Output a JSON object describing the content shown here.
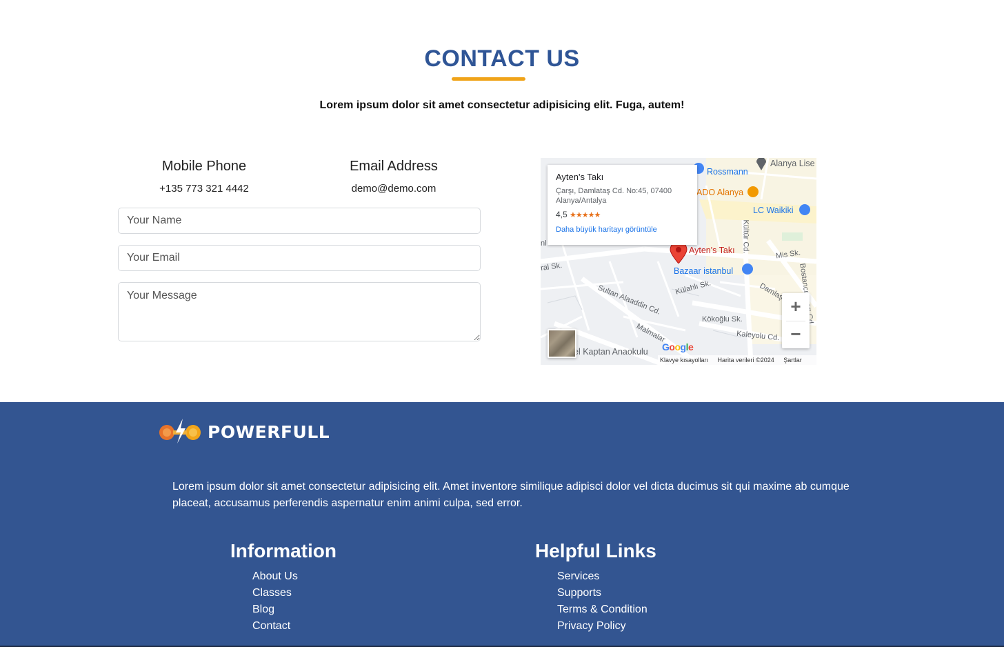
{
  "contact": {
    "title": "CONTACT US",
    "lead": "Lorem ipsum dolor sit amet consectetur adipisicing elit. Fuga, autem!",
    "accent_color": "#f0a318",
    "title_color": "#2f5596",
    "phone": {
      "label": "Mobile Phone",
      "value": "+135 773 321 4442"
    },
    "email": {
      "label": "Email Address",
      "value": "demo@demo.com"
    },
    "form": {
      "name_placeholder": "Your Name",
      "email_placeholder": "Your Email",
      "message_placeholder": "Your Message"
    }
  },
  "map": {
    "card": {
      "title": "Ayten's Takı",
      "address": "Çarşı, Damlataş Cd. No:45, 07400 Alanya/Antalya",
      "rating": "4,5",
      "stars": "★★★★★",
      "link": "Daha büyük haritayı görüntüle"
    },
    "places": {
      "alanya_lise": "Alanya Lise",
      "rossmann": "Rossmann",
      "ado_alanya": "ADO Alanya",
      "lc_waikiki": "LC Waikiki",
      "aytens_taki": "Ayten's Takı",
      "bazaar_istanbul": "Bazaar istanbul",
      "mis_sk": "Mis Sk.",
      "kulahli_sk": "Külahlı Sk.",
      "kokoglu_sk": "Kökoğlu Sk.",
      "kaleyolu_cd": "Kaleyolu Cd.",
      "sultan_alaaddin_cd": "Sultan Alaaddin Cd.",
      "malmalar": "Malmalar",
      "kaptan_anaokulu": "el Kaptan Anaokulu",
      "kultur_cd": "Kültür Cd.",
      "bostancipinari_cd": "Bostancıpınarı Cd.",
      "damlatas": "Damlaş",
      "ral_sk": "ral Sk.",
      "nl": "nl"
    },
    "google": "Google",
    "footer": {
      "shortcuts": "Klavye kısayolları",
      "data": "Harita verileri ©2024",
      "terms": "Şartlar"
    },
    "zoom_in": "+",
    "zoom_out": "−"
  },
  "footer": {
    "background": "#335591",
    "brand": "POWERFULL",
    "about": "Lorem ipsum dolor sit amet consectetur adipisicing elit. Amet inventore similique adipisci dolor vel dicta ducimus sit qui maxime ab cumque placeat, accusamus perferendis aspernatur enim animi culpa, sed error.",
    "information": {
      "heading": "Information",
      "links": [
        "About Us",
        "Classes",
        "Blog",
        "Contact"
      ]
    },
    "helpful": {
      "heading": "Helpful Links",
      "links": [
        "Services",
        "Supports",
        "Terms & Condition",
        "Privacy Policy"
      ]
    }
  }
}
